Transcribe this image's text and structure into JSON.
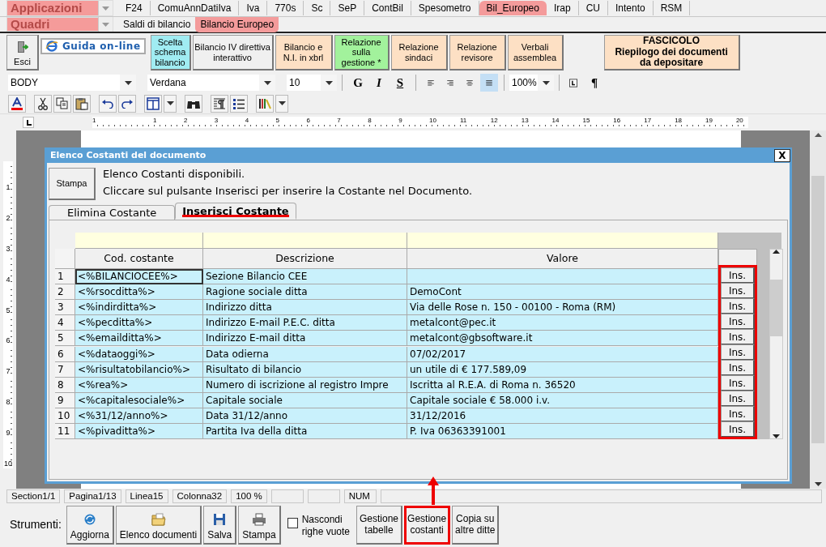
{
  "app_selector": {
    "label": "Applicazioni"
  },
  "app_tabs": [
    {
      "label": "F24",
      "selected": false
    },
    {
      "label": "ComuAnnDatiIva",
      "selected": false
    },
    {
      "label": "Iva",
      "selected": false
    },
    {
      "label": "770s",
      "selected": false
    },
    {
      "label": "Sc",
      "selected": false
    },
    {
      "label": "SeP",
      "selected": false
    },
    {
      "label": "ContBil",
      "selected": false
    },
    {
      "label": "Spesometro",
      "selected": false
    },
    {
      "label": "Bil_Europeo",
      "selected": true
    },
    {
      "label": "Irap",
      "selected": false
    },
    {
      "label": "CU",
      "selected": false
    },
    {
      "label": "Intento",
      "selected": false
    },
    {
      "label": "RSM",
      "selected": false
    }
  ],
  "section_selector": {
    "label": "Quadri"
  },
  "section_tabs": [
    {
      "label": "Saldi di bilancio",
      "selected": false
    },
    {
      "label": "Bilancio Europeo",
      "selected": true
    }
  ],
  "ribbon": [
    {
      "kind": "iconbutton",
      "label": "Esci"
    },
    {
      "kind": "link",
      "label": "Guida on-line"
    },
    {
      "kind": "button",
      "label": "Scelta\nschema\nbilancio",
      "color": "#a0ecf2"
    },
    {
      "kind": "button",
      "label": "Bilancio IV direttiva\ninterattivo",
      "color": "#f0f0f0"
    },
    {
      "kind": "button",
      "label": "Bilancio e\nN.I. in xbrl",
      "color": "#fde0c4"
    },
    {
      "kind": "button",
      "label": "Relazione\nsulla\ngestione *",
      "color": "#a2f29c"
    },
    {
      "kind": "button",
      "label": "Relazione\nsindaci",
      "color": "#fde0c4"
    },
    {
      "kind": "button",
      "label": "Relazione\nrevisore",
      "color": "#fde0c4"
    },
    {
      "kind": "button",
      "label": "Verbali\nassemblea",
      "color": "#fde0c4"
    }
  ],
  "dossier_button": {
    "label": "FASCICOLO\nRiepilogo dei documenti\nda depositare"
  },
  "format_bar": {
    "style": "BODY",
    "font": "Verdana",
    "size": "10",
    "text_styles": [
      {
        "kind": "bold",
        "label": "G"
      },
      {
        "kind": "italic",
        "label": "I"
      },
      {
        "kind": "underline",
        "label": "S"
      }
    ],
    "alignments": [
      {
        "kind": "left",
        "selected": false
      },
      {
        "kind": "right",
        "selected": false
      },
      {
        "kind": "center",
        "selected": false
      },
      {
        "kind": "justify",
        "selected": true
      }
    ],
    "zoom": "100%",
    "pilcrow": "¶"
  },
  "ruler": {
    "labels": [
      "1",
      "1",
      "2",
      "3",
      "4",
      "5",
      "6",
      "7",
      "8",
      "9",
      "10",
      "11",
      "12",
      "13",
      "14",
      "15",
      "16",
      "17",
      "18",
      "19",
      "20"
    ]
  },
  "vertical_ruler": {
    "labels": [
      "1",
      "2",
      "3",
      "4",
      "5",
      "6",
      "7",
      "8",
      "9",
      "10"
    ]
  },
  "dialog": {
    "title": "Elenco Costanti del documento",
    "close": "X",
    "print_button": "Stampa",
    "lines": [
      "Elenco Costanti disponibili.",
      "Cliccare sul pulsante Inserisci per inserire la Costante nel Documento."
    ],
    "tabs": [
      {
        "label": "Elimina Costante",
        "selected": false,
        "underlined": false
      },
      {
        "label": "Inserisci Costante",
        "selected": true,
        "underlined": true
      }
    ],
    "table": {
      "columns": [
        "Cod. costante",
        "Descrizione",
        "Valore"
      ],
      "action_column_highlighted": true,
      "rows": [
        {
          "number": "1",
          "code": "<%BILANCIOCEE%>",
          "description": "Sezione Bilancio CEE",
          "value": "",
          "action": "Ins.",
          "selected": true
        },
        {
          "number": "2",
          "code": "<%rsocditta%>",
          "description": "Ragione sociale ditta",
          "value": " DemoCont",
          "action": "Ins.",
          "selected": false
        },
        {
          "number": "3",
          "code": "<%indirditta%>",
          "description": "Indirizzo ditta",
          "value": "Via delle Rose n. 150 - 00100 - Roma (RM)",
          "action": "Ins.",
          "selected": false
        },
        {
          "number": "4",
          "code": "<%pecditta%>",
          "description": "Indirizzo E-mail P.E.C. ditta",
          "value": "metalcont@pec.it",
          "action": "Ins.",
          "selected": false
        },
        {
          "number": "5",
          "code": "<%emailditta%>",
          "description": "Indirizzo E-mail ditta",
          "value": "metalcont@gbsoftware.it",
          "action": "Ins.",
          "selected": false
        },
        {
          "number": "6",
          "code": "<%dataoggi%>",
          "description": "Data odierna",
          "value": "07/02/2017",
          "action": "Ins.",
          "selected": false
        },
        {
          "number": "7",
          "code": "<%risultatobilancio%>",
          "description": "Risultato di bilancio",
          "value": "un utile di € 177.589,09",
          "action": "Ins.",
          "selected": false
        },
        {
          "number": "8",
          "code": "<%rea%>",
          "description": "Numero di iscrizione al registro Impre",
          "value": "Iscritta al R.E.A. di Roma n. 36520",
          "action": "Ins.",
          "selected": false
        },
        {
          "number": "9",
          "code": "<%capitalesociale%>",
          "description": "Capitale sociale",
          "value": "Capitale sociale € 58.000 i.v.",
          "action": "Ins.",
          "selected": false
        },
        {
          "number": "10",
          "code": "<%31/12/anno%>",
          "description": "Data 31/12/anno",
          "value": "31/12/2016",
          "action": "Ins.",
          "selected": false
        },
        {
          "number": "11",
          "code": "<%pivaditta%>",
          "description": "Partita Iva della ditta",
          "value": "P. Iva 06363391001",
          "action": "Ins.",
          "selected": false
        }
      ]
    }
  },
  "status_bar": [
    {
      "kind": "text",
      "text": "Section1/1"
    },
    {
      "kind": "text",
      "text": "Pagina1/13"
    },
    {
      "kind": "text",
      "text": "Linea15"
    },
    {
      "kind": "text",
      "text": "Colonna32"
    },
    {
      "kind": "text",
      "text": "100 %"
    },
    {
      "kind": "blank"
    },
    {
      "kind": "blank"
    },
    {
      "kind": "text",
      "text": "NUM"
    },
    {
      "kind": "blank"
    }
  ],
  "tools": {
    "label": "Strumenti:",
    "items": [
      {
        "kind": "refresh",
        "label": "Aggiorna"
      },
      {
        "kind": "folder",
        "label": "Elenco documenti"
      },
      {
        "kind": "save",
        "label": "Salva"
      },
      {
        "kind": "print",
        "label": "Stampa"
      },
      {
        "kind": "checkbox",
        "label": "Nascondi\nrighe vuote",
        "checked": false
      },
      {
        "kind": "text",
        "label": "Gestione\ntabelle",
        "highlighted": false
      },
      {
        "kind": "text",
        "label": "Gestione\ncostanti",
        "highlighted": true
      },
      {
        "kind": "text",
        "label": "Copia su\naltre ditte",
        "highlighted": false
      }
    ]
  }
}
